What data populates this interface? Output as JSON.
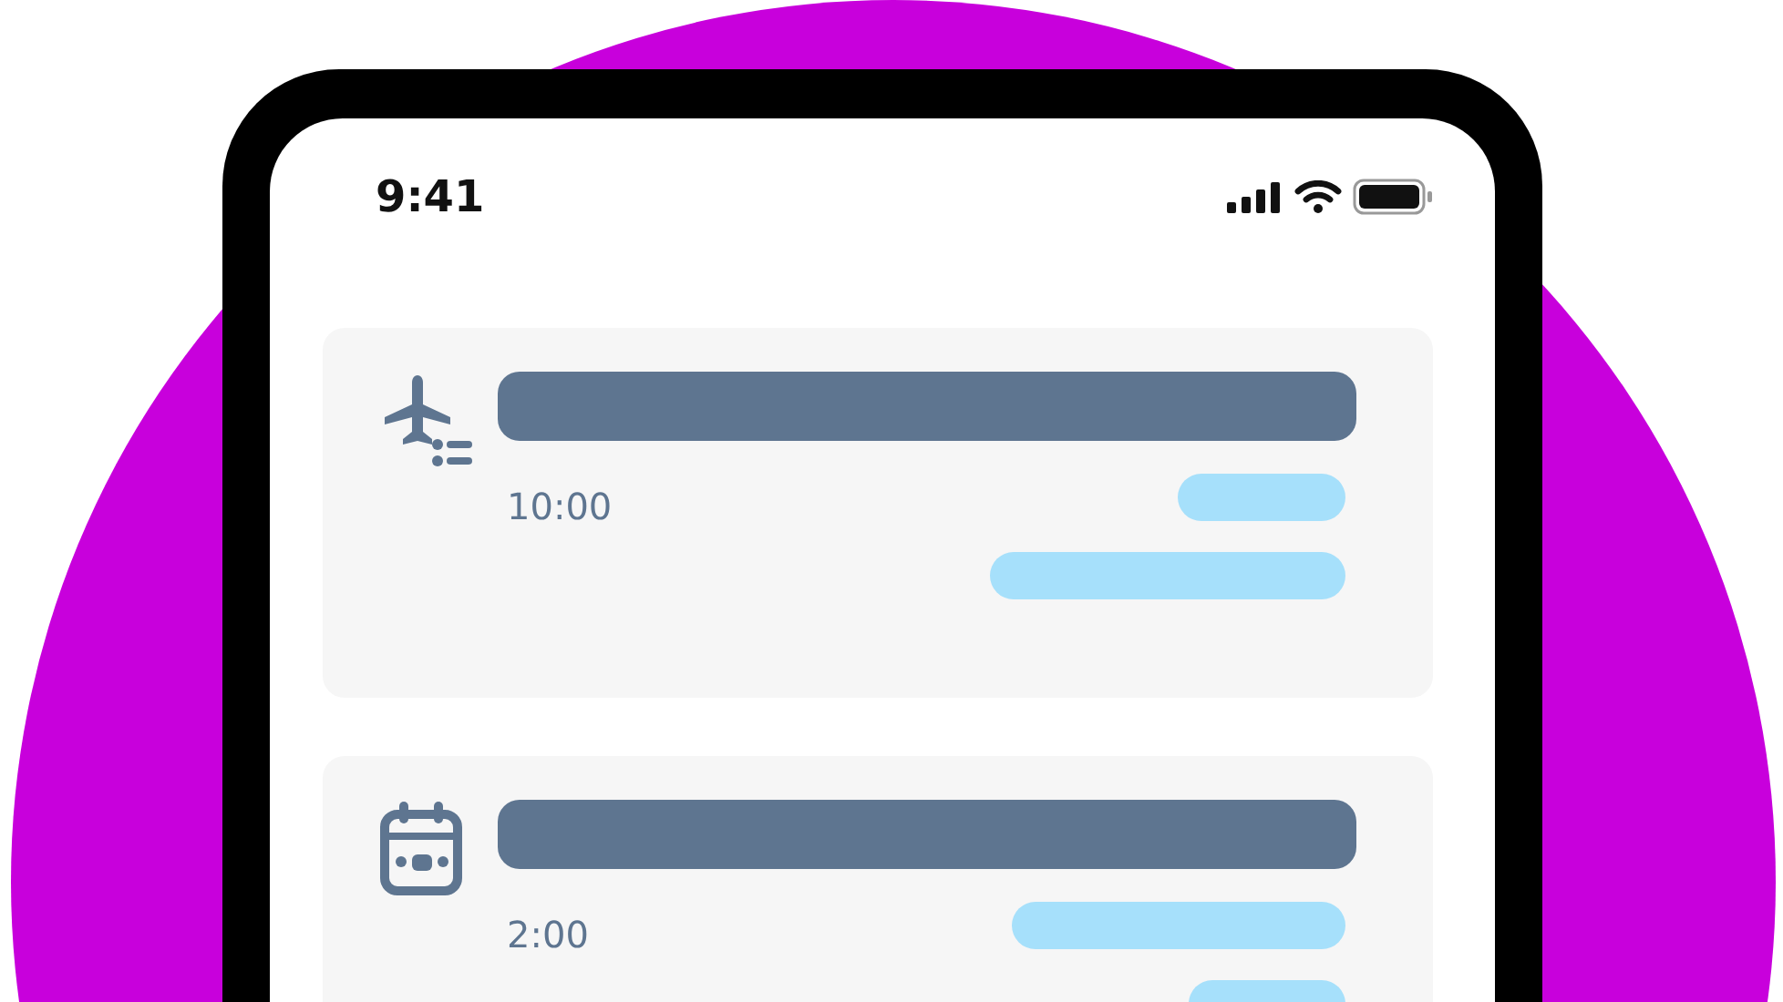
{
  "status_bar": {
    "time": "9:41"
  },
  "cards": [
    {
      "kind": "flight",
      "time": "10:00"
    },
    {
      "kind": "calendar",
      "time": "2:00"
    }
  ]
}
